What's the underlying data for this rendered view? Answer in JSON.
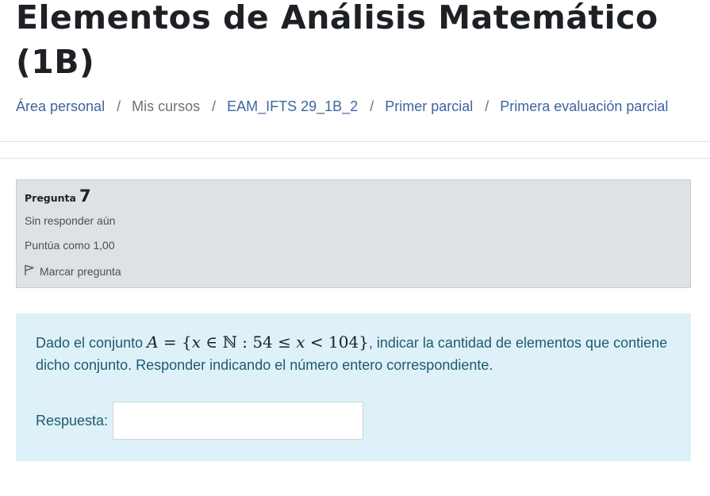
{
  "page": {
    "title": "Elementos de Análisis Matemático (1B)"
  },
  "breadcrumb": {
    "items": [
      {
        "label": "Área personal",
        "link": true
      },
      {
        "label": "Mis cursos",
        "link": false
      },
      {
        "label": "EAM_IFTS 29_1B_2",
        "link": true
      },
      {
        "label": "Primer parcial",
        "link": true
      },
      {
        "label": "Primera evaluación parcial",
        "link": true
      }
    ],
    "separator": "/"
  },
  "question": {
    "word": "Pregunta",
    "number": "7",
    "state": "Sin responder aún",
    "grade": "Puntúa como 1,00",
    "flag_label": "Marcar pregunta",
    "text_before": "Dado el conjunto ",
    "math": {
      "A": "A",
      "eq": " = {",
      "x1": "x",
      "in": " ∈ ",
      "N": "ℕ",
      "colon": " : 54 ≤ ",
      "x2": "x",
      "lt": " < 104}"
    },
    "text_after": ", indicar la cantidad de elementos que contiene dicho conjunto. Responder indicando el número entero correspondiente.",
    "answer_label": "Respuesta:",
    "answer_value": ""
  },
  "colors": {
    "info_bg": "#dee2e6",
    "formulation_bg": "#def1f8",
    "link": "#3e65a0"
  },
  "icons": {
    "flag": "flag-icon"
  }
}
